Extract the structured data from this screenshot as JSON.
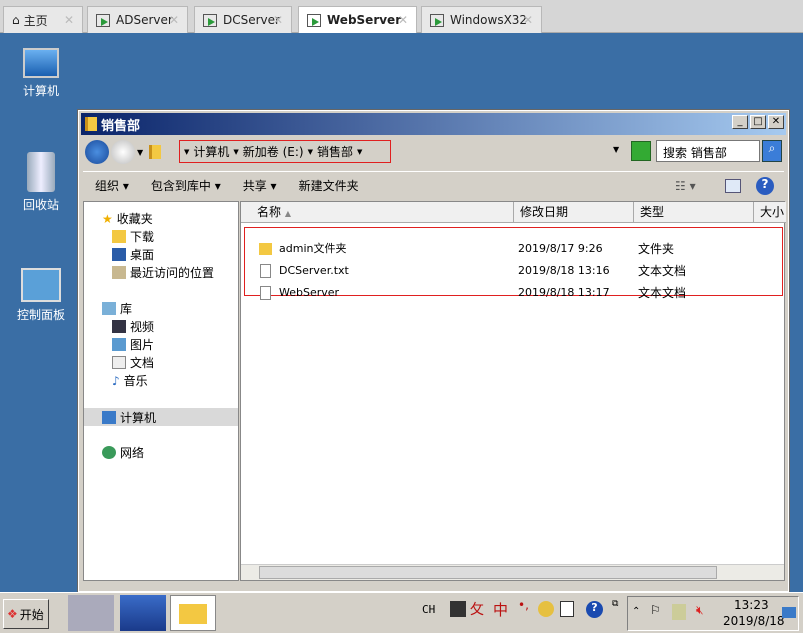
{
  "tabs": [
    {
      "label": "主页",
      "icon": "home-icon"
    },
    {
      "label": "ADServer"
    },
    {
      "label": "DCServer"
    },
    {
      "label": "WebServer",
      "active": true
    },
    {
      "label": "WindowsX32"
    }
  ],
  "desktop": [
    "计算机",
    "回收站",
    "控制面板"
  ],
  "window": {
    "title": "销售部",
    "breadcrumb": [
      "计算机",
      "新加卷 (E:)",
      "销售部"
    ],
    "search_placeholder": "搜索 销售部",
    "toolbar": [
      "组织",
      "包含到库中",
      "共享",
      "新建文件夹"
    ],
    "sidebar": {
      "favorites": "收藏夹",
      "fav_items": [
        "下载",
        "桌面",
        "最近访问的位置"
      ],
      "libraries": "库",
      "lib_items": [
        "视频",
        "图片",
        "文档",
        "音乐"
      ],
      "computer": "计算机",
      "network": "网络"
    },
    "columns": [
      "名称",
      "修改日期",
      "类型",
      "大小"
    ],
    "files": [
      {
        "name": "admin文件夹",
        "date": "2019/8/17 9:26",
        "type": "文件夹",
        "icon": "folder-icon"
      },
      {
        "name": "DCServer.txt",
        "date": "2019/8/18 13:16",
        "type": "文本文档",
        "icon": "file-icon"
      },
      {
        "name": "WebServer",
        "date": "2019/8/18 13:17",
        "type": "文本文档",
        "icon": "file-icon"
      }
    ]
  },
  "taskbar": {
    "start": "开始",
    "lang": "CH",
    "ime": "中",
    "time": "13:23",
    "date": "2019/8/18"
  }
}
